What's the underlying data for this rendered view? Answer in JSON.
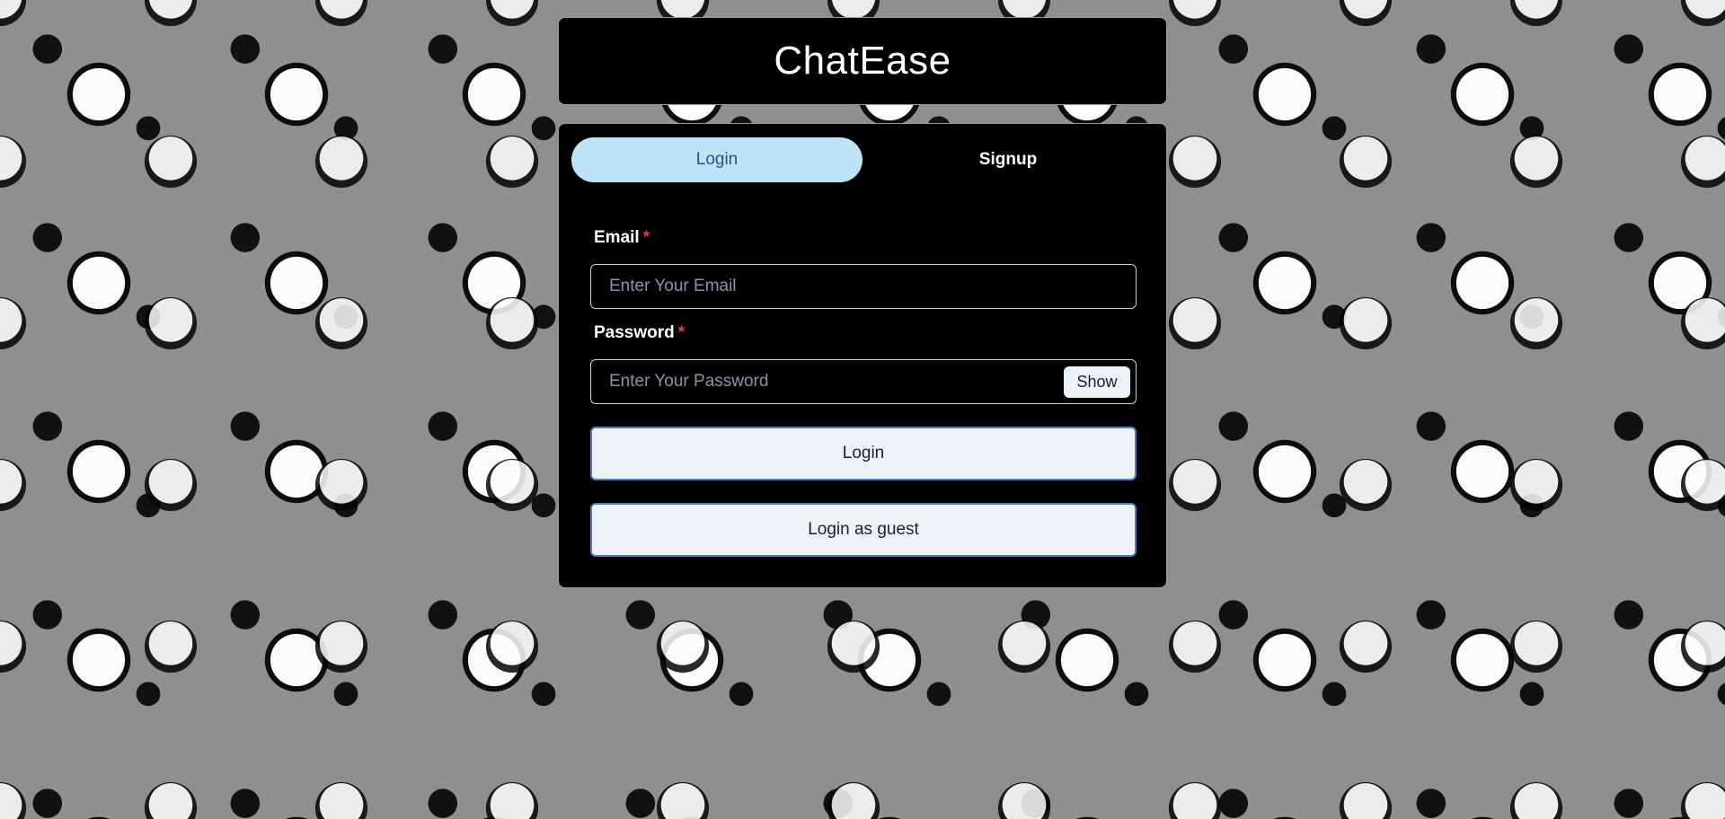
{
  "app": {
    "title": "ChatEase"
  },
  "tabs": [
    {
      "label": "Login",
      "active": true
    },
    {
      "label": "Signup",
      "active": false
    }
  ],
  "form": {
    "email": {
      "label": "Email",
      "required_mark": "*",
      "placeholder": "Enter Your Email",
      "value": ""
    },
    "password": {
      "label": "Password",
      "required_mark": "*",
      "placeholder": "Enter Your Password",
      "value": "",
      "toggle_label": "Show"
    },
    "login_button": "Login",
    "guest_button": "Login as guest"
  },
  "colors": {
    "active_tab_bg": "#bee3f8",
    "active_tab_text": "#2c5282",
    "required": "#e53e3e",
    "button_bg": "#edf2f7",
    "button_border": "#4a7fc1",
    "card_bg": "#000000"
  }
}
